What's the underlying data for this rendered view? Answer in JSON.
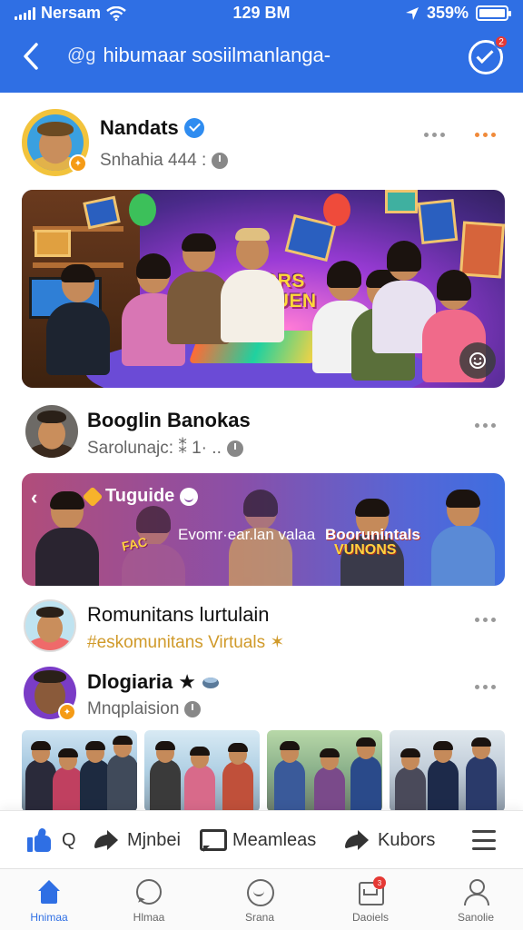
{
  "status_bar": {
    "carrier": "Nersam",
    "time": "129 BM",
    "battery_text": "359%"
  },
  "nav": {
    "title": "hibumaar sosiilmanlanga-",
    "title_prefix": "@g",
    "notification_count": "2"
  },
  "posts": [
    {
      "name": "Nandats",
      "subtitle": "Snhahia 444 :",
      "media_title": "FACRS VIONUEN"
    },
    {
      "name": "Booglin Banokas",
      "subtitle": "Sarolunajc: ⁑ 1· ..",
      "banner": {
        "title": "Tuguide",
        "slogan": "Evomr·ear.lan valaa",
        "headline": "Boorunintals",
        "headline_sub": "VUNONS",
        "logo_text": "FAC"
      }
    },
    {
      "name": "Romunitans lurtulain",
      "subtitle": "#eskomunitans Virtuals ✶"
    },
    {
      "name": "Dlogiaria ★",
      "subtitle": "Mnqplaision"
    }
  ],
  "action_bar": {
    "like_label": "Q",
    "share_label": "Mjnbei",
    "comment_label": "Meamleas",
    "forward_label": "Kubors"
  },
  "tabs": [
    {
      "label": "Hnimaa",
      "icon": "home-icon"
    },
    {
      "label": "Hlmaa",
      "icon": "chat-icon"
    },
    {
      "label": "Srana",
      "icon": "smile-icon"
    },
    {
      "label": "Daoiels",
      "icon": "inbox-icon",
      "badge": "3"
    },
    {
      "label": "Sanolie",
      "icon": "user-icon"
    }
  ],
  "colors": {
    "header_blue": "#2f6fe4",
    "badge_red": "#e53935",
    "badge_orange": "#f59b16",
    "verified_blue": "#2f8cf0"
  }
}
